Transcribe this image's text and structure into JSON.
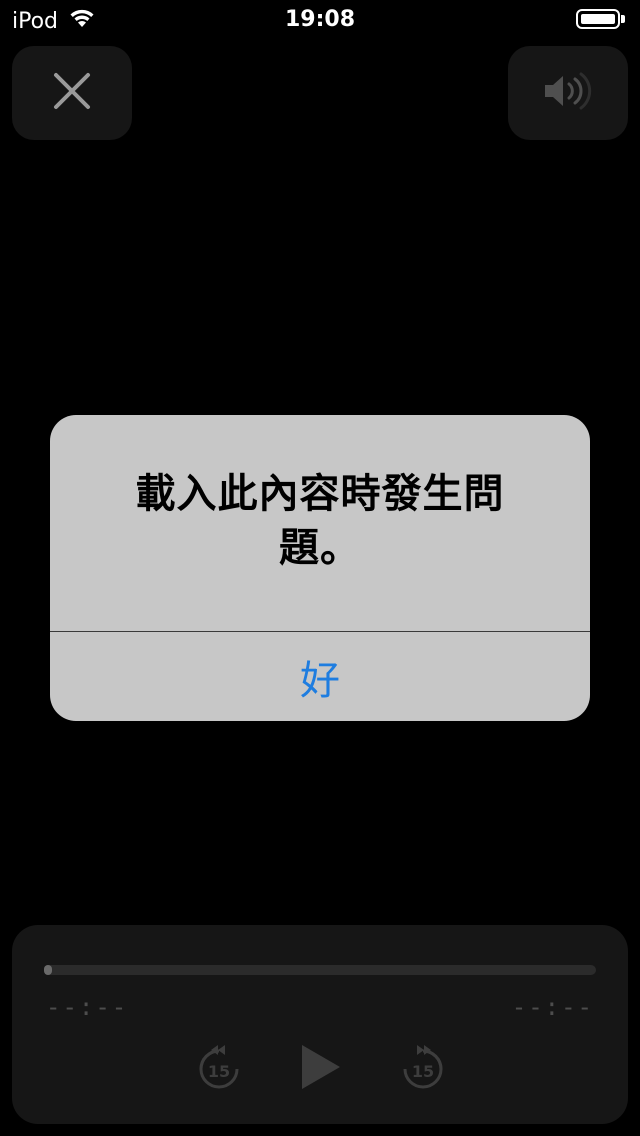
{
  "status_bar": {
    "carrier": "iPod",
    "time": "19:08",
    "wifi_icon": "wifi-icon",
    "battery_icon": "battery-icon",
    "battery_level": 1.0
  },
  "top_controls": {
    "close_icon": "close-icon",
    "volume_icon": "volume-icon"
  },
  "alert": {
    "message": "載入此內容時發生問題。",
    "ok_label": "好"
  },
  "player": {
    "elapsed": "--:--",
    "remaining": "--:--",
    "progress": 0,
    "skip_back_label": "15",
    "skip_forward_label": "15",
    "play_icon": "play-icon",
    "skip_back_icon": "skip-back-15-icon",
    "skip_forward_icon": "skip-forward-15-icon"
  },
  "colors": {
    "background": "#000000",
    "panel": "#161616",
    "alert_bg": "#c7c7c7",
    "accent": "#1e7de0",
    "muted": "#4d4d4d"
  }
}
